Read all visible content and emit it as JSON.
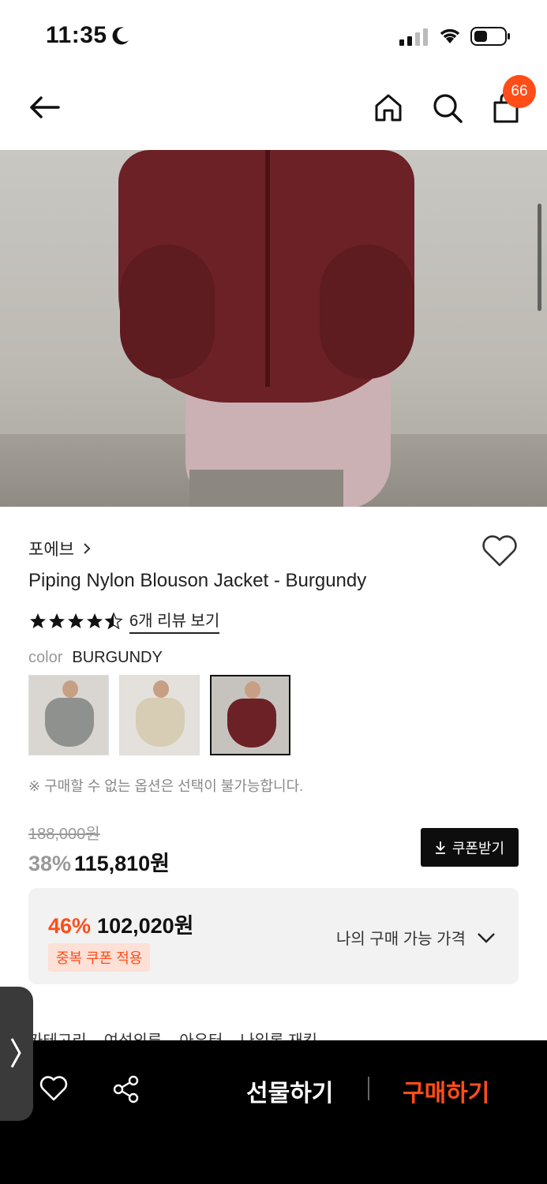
{
  "status_bar": {
    "time": "11:35"
  },
  "nav": {
    "cart_count": "66"
  },
  "product": {
    "brand": "포에브",
    "title": "Piping Nylon Blouson Jacket - Burgundy",
    "rating_stars": 4.5,
    "review_link": "6개 리뷰 보기",
    "color_label": "color",
    "color_value": "BURGUNDY",
    "swatches": [
      {
        "name": "gray",
        "color": "#8e918d"
      },
      {
        "name": "beige",
        "color": "#d7ccb4"
      },
      {
        "name": "burgundy",
        "color": "#6b2126"
      }
    ],
    "notice": "※ 구매할 수 없는 옵션은 선택이 불가능합니다."
  },
  "price": {
    "original": "188,000원",
    "discount_pct": "38%",
    "sale_price": "115,810원",
    "coupon_button": "쿠폰받기",
    "best_pct": "46%",
    "best_price": "102,020원",
    "duplicate_coupon_badge": "중복 쿠폰 적용",
    "my_price_label": "나의 구매 가능 가격"
  },
  "category": {
    "label": "카테고리",
    "path": [
      "여성의류",
      "아우터",
      "나일론 재킷"
    ]
  },
  "bottom_bar": {
    "gift": "선물하기",
    "buy": "구매하기"
  },
  "colors": {
    "accent": "#ff4d1a",
    "dark": "#0d0d0d"
  }
}
